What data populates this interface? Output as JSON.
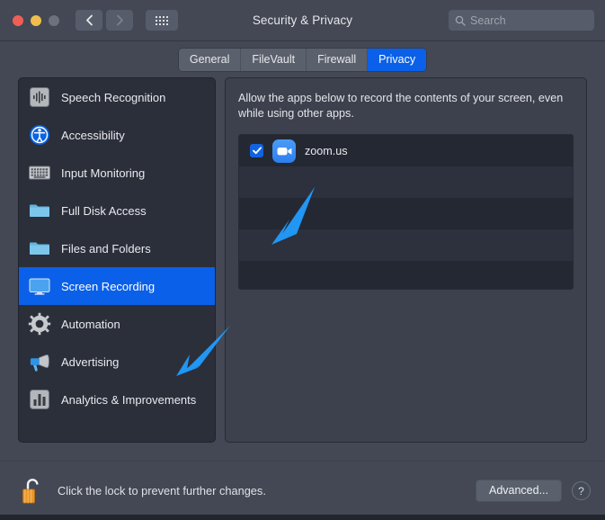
{
  "window": {
    "title": "Security & Privacy",
    "traffic_lights": [
      "close",
      "minimize",
      "zoom"
    ],
    "nav": {
      "back_icon": "chevron-left-icon",
      "forward_icon": "chevron-right-icon",
      "grid_icon": "show-all-grid-icon"
    },
    "search": {
      "placeholder": "Search",
      "icon": "search-icon",
      "value": ""
    }
  },
  "tabs": [
    {
      "label": "General",
      "active": false
    },
    {
      "label": "FileVault",
      "active": false
    },
    {
      "label": "Firewall",
      "active": false
    },
    {
      "label": "Privacy",
      "active": true
    }
  ],
  "sidebar": {
    "items": [
      {
        "label": "Speech Recognition",
        "icon": "waveform-icon",
        "selected": false
      },
      {
        "label": "Accessibility",
        "icon": "accessibility-icon",
        "selected": false
      },
      {
        "label": "Input Monitoring",
        "icon": "keyboard-icon",
        "selected": false
      },
      {
        "label": "Full Disk Access",
        "icon": "folder-icon",
        "selected": false
      },
      {
        "label": "Files and Folders",
        "icon": "folder-icon",
        "selected": false
      },
      {
        "label": "Screen Recording",
        "icon": "display-icon",
        "selected": true
      },
      {
        "label": "Automation",
        "icon": "gear-icon",
        "selected": false
      },
      {
        "label": "Advertising",
        "icon": "megaphone-icon",
        "selected": false
      },
      {
        "label": "Analytics & Improvements",
        "icon": "bar-chart-icon",
        "selected": false
      }
    ]
  },
  "main": {
    "description": "Allow the apps below to record the contents of your screen, even while using other apps.",
    "apps": [
      {
        "name": "zoom.us",
        "checked": true,
        "icon": "video-camera-icon"
      },
      {
        "name": "",
        "checked": false,
        "icon": ""
      },
      {
        "name": "",
        "checked": false,
        "icon": ""
      },
      {
        "name": "",
        "checked": false,
        "icon": ""
      },
      {
        "name": "",
        "checked": false,
        "icon": ""
      }
    ]
  },
  "footer": {
    "lock_icon": "unlocked-padlock-icon",
    "lock_text": "Click the lock to prevent further changes.",
    "advanced_label": "Advanced...",
    "help_label": "?"
  },
  "annotations": [
    {
      "name": "arrow-to-screen-recording",
      "color": "#2196f3"
    },
    {
      "name": "arrow-to-checkbox",
      "color": "#2196f3"
    }
  ],
  "colors": {
    "accent_blue": "#0a60e8",
    "window_bg": "#434854",
    "sidebar_bg": "#2b2f3a",
    "panel_bg": "#3c414d",
    "list_bg": "#242833",
    "annotation_blue": "#2196f3",
    "lock_orange": "#e8962c"
  }
}
